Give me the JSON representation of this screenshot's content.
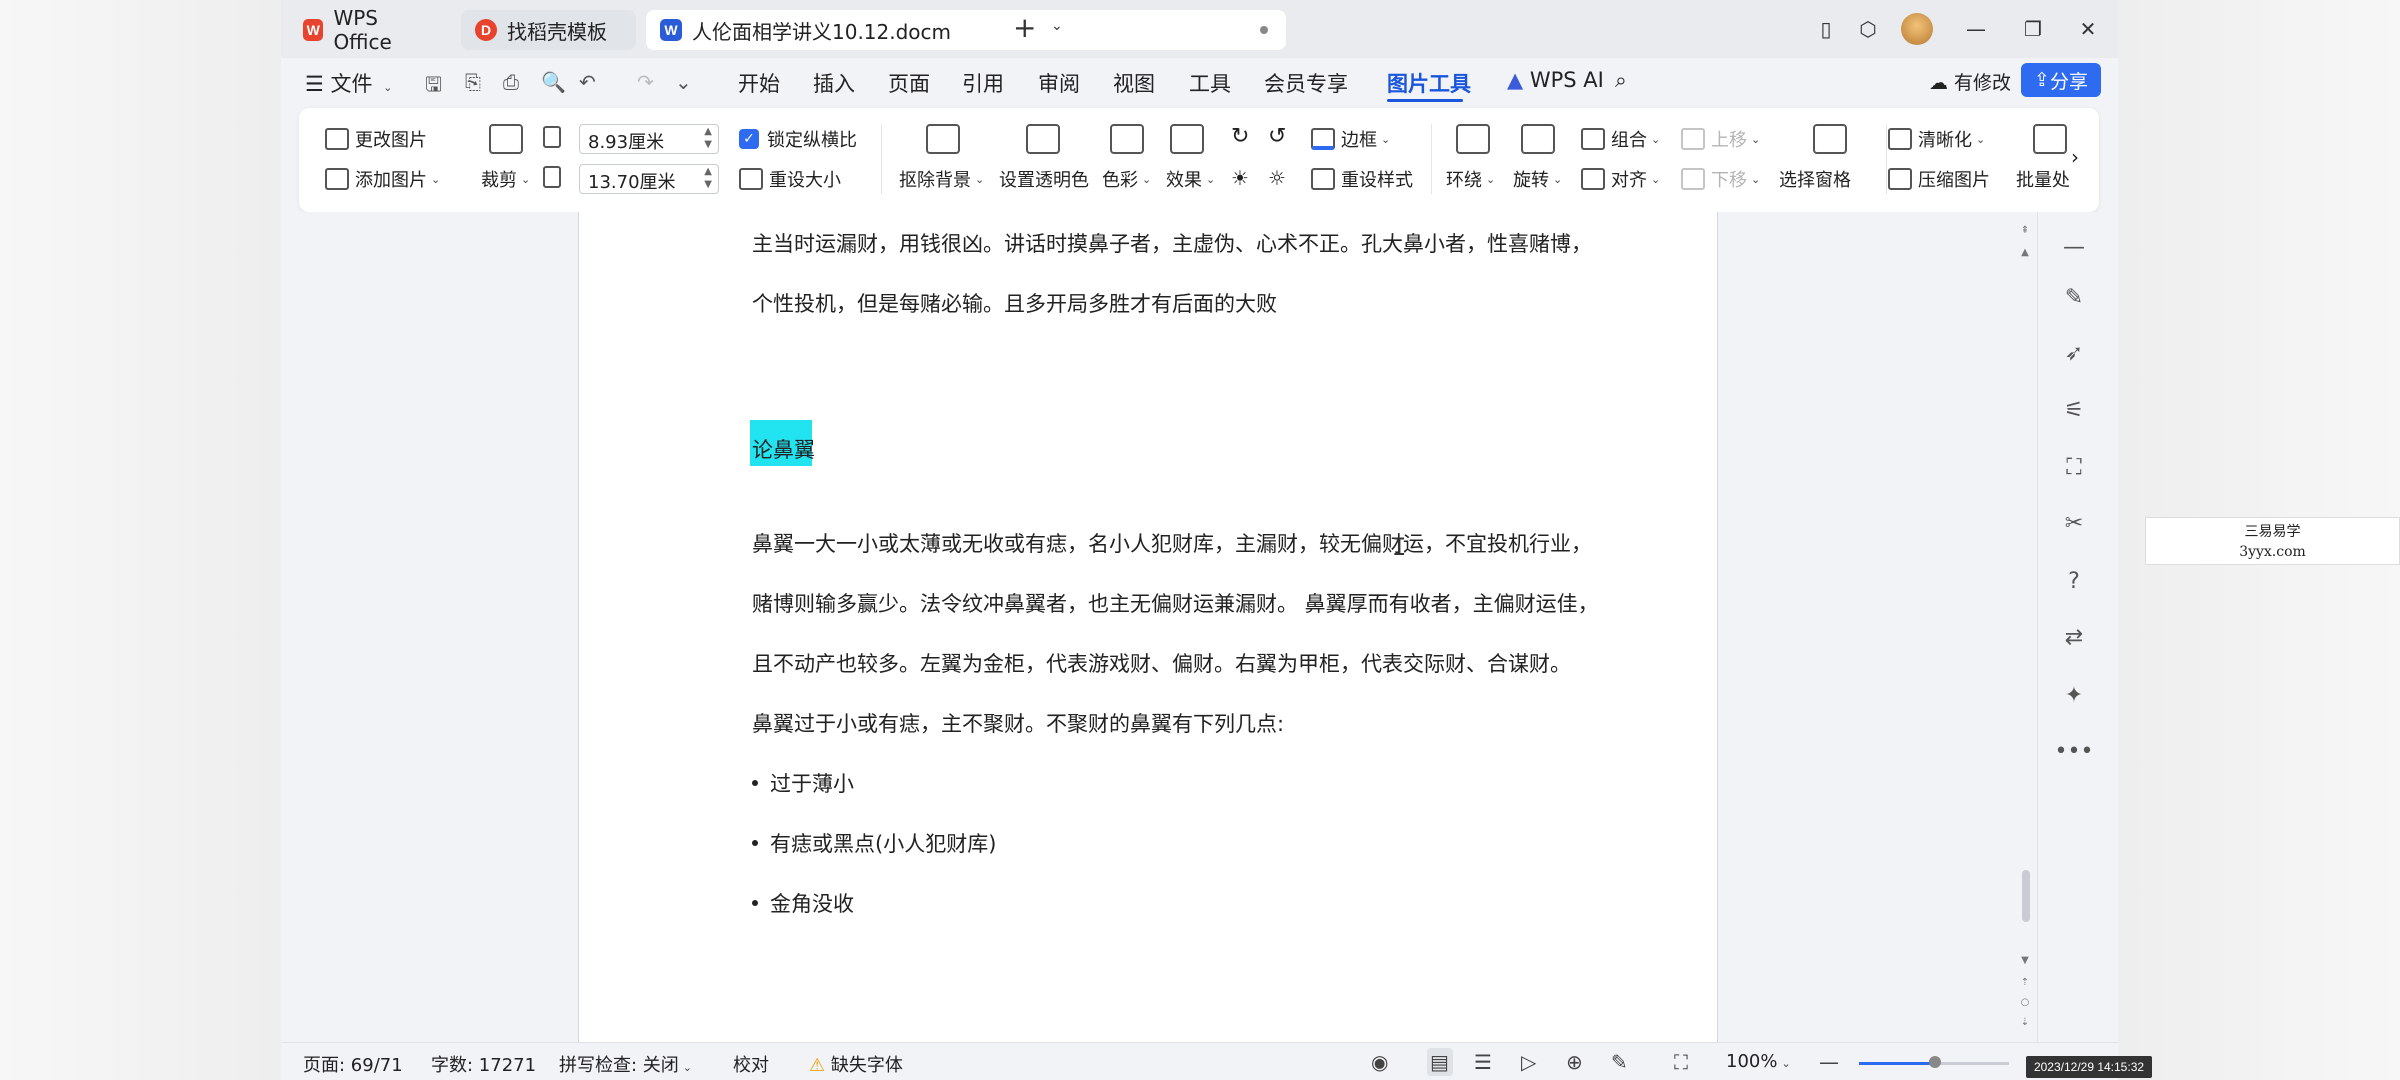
{
  "tabs": {
    "wps_label": "WPS Office",
    "wps_logo": "W",
    "template_label": "找稻壳模板",
    "template_logo": "D",
    "doc_label": "人伦面相学讲义10.12.docm",
    "doc_logo": "W"
  },
  "menu": {
    "file": "文件",
    "items": [
      "开始",
      "插入",
      "页面",
      "引用",
      "审阅",
      "视图",
      "工具",
      "会员专享",
      "图片工具"
    ],
    "active": "图片工具",
    "wps_ai": "WPS AI",
    "modify": "有修改",
    "share": "分享"
  },
  "ribbon": {
    "change_picture": "更改图片",
    "add_picture": "添加图片",
    "crop": "裁剪",
    "width": "8.93厘米",
    "height": "13.70厘米",
    "lock_ratio": "锁定纵横比",
    "reset_size": "重设大小",
    "remove_bg": "抠除背景",
    "set_transparent": "设置透明色",
    "color": "色彩",
    "effect": "效果",
    "border": "边框",
    "reset_style": "重设样式",
    "wrap": "环绕",
    "rotate": "旋转",
    "group": "组合",
    "align": "对齐",
    "move_up": "上移",
    "move_down": "下移",
    "select_pane": "选择窗格",
    "sharpen": "清晰化",
    "compress": "压缩图片",
    "batch": "批量处"
  },
  "document": {
    "lines": [
      "主当时运漏财，用钱很凶。讲话时摸鼻子者，主虚伪、心术不正。孔大鼻小者，性喜赌博，",
      "个性投机，但是每赌必输。且多开局多胜才有后面的大败"
    ],
    "heading": "论鼻翼",
    "body": [
      "鼻翼一大一小或太薄或无收或有痣，名小人犯财库，主漏财，较无偏财运，不宜投机行业，",
      "赌博则输多赢少。法令纹冲鼻翼者，也主无偏财运兼漏财。 鼻翼厚而有收者，主偏财运佳，",
      "且不动产也较多。左翼为金柜，代表游戏财、偏财。右翼为甲柜，代表交际财、合谋财。",
      "鼻翼过于小或有痣，主不聚财。不聚财的鼻翼有下列几点:"
    ],
    "bullets": [
      "过于薄小",
      "有痣或黑点(小人犯财库)",
      "金角没收"
    ]
  },
  "status": {
    "page": "页面: 69/71",
    "words": "字数: 17271",
    "spellcheck": "拼写检查: 关闭",
    "proofread": "校对",
    "missing_font": "缺失字体",
    "zoom": "100%",
    "zoom_fraction": 0.5
  },
  "watermark": {
    "line1": "三易易学",
    "line2": "3yyx.com"
  },
  "timestamp": "2023/12/29 14:15:32",
  "colors": {
    "accent": "#2f6bf0",
    "highlight": "#22e3f0",
    "active_tab_text": "#1a56db"
  }
}
